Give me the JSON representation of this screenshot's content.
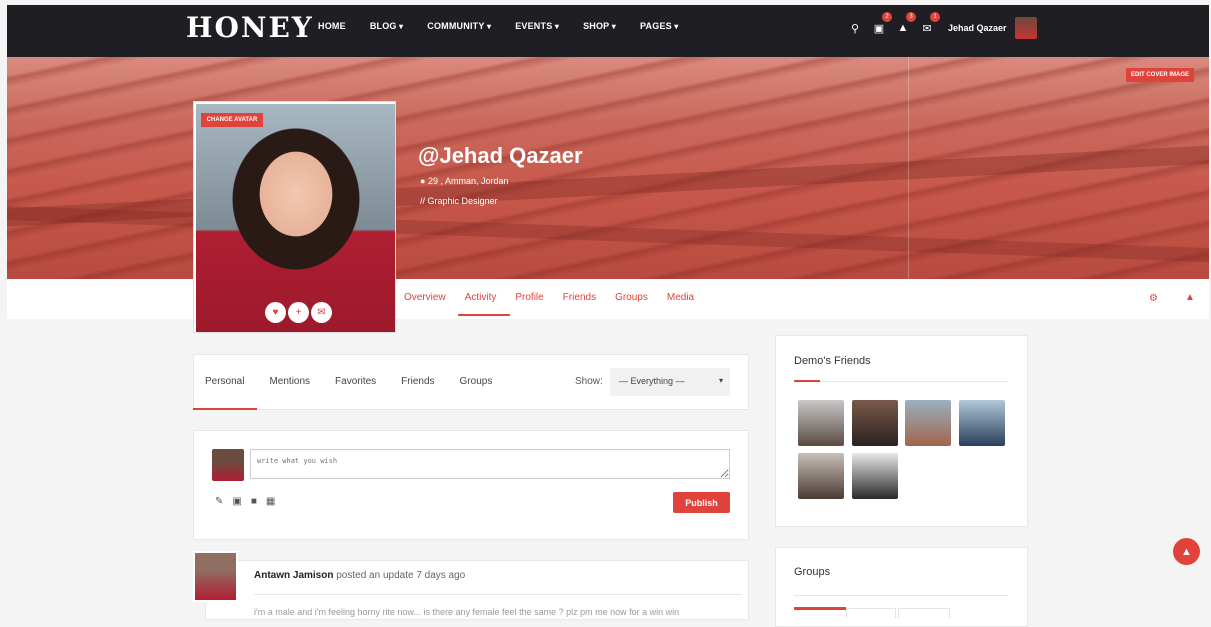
{
  "header": {
    "logo": "HONEY",
    "nav": [
      {
        "label": "HOME",
        "dropdown": false
      },
      {
        "label": "BLOG",
        "dropdown": true
      },
      {
        "label": "COMMUNITY",
        "dropdown": true
      },
      {
        "label": "EVENTS",
        "dropdown": true
      },
      {
        "label": "SHOP",
        "dropdown": true
      },
      {
        "label": "PAGES",
        "dropdown": true
      }
    ],
    "icons": {
      "search": "search-icon",
      "cart": "cart-icon",
      "bell": "bell-icon",
      "mail": "mail-icon"
    },
    "badges": {
      "cart": "2",
      "bell": "3",
      "mail": "1"
    },
    "username": "Jehad Qazaer"
  },
  "cover": {
    "edit_label": "EDIT COVER IMAGE"
  },
  "profile": {
    "change_avatar_label": "CHANGE AVATAR",
    "name": "@Jehad Qazaer",
    "location": "29 , Amman, Jordan",
    "job": "// Graphic Designer",
    "tabs": [
      "Overview",
      "Activity",
      "Profile",
      "Friends",
      "Groups",
      "Media"
    ],
    "active_tab": "Activity"
  },
  "activity_filter": {
    "tabs": [
      "Personal",
      "Mentions",
      "Favorites",
      "Friends",
      "Groups"
    ],
    "active_tab": "Personal",
    "show_label": "Show:",
    "show_value": "— Everything —"
  },
  "composer": {
    "placeholder": "write what you wish",
    "publish_label": "Publish"
  },
  "feed": {
    "author": "Antawn Jamison",
    "action": " posted an update 7 days ago",
    "text": "i'm a male and i'm feeling horny rite now... is there any female feel the same ? plz pm me now for a win win"
  },
  "sidebar": {
    "friends_title": "Demo's Friends",
    "groups_title": "Groups"
  },
  "colors": {
    "accent": "#e0433b",
    "topbar": "#1f1f23"
  }
}
